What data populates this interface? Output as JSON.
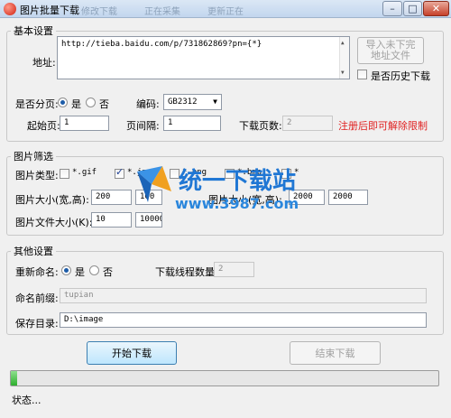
{
  "window": {
    "title": "图片批量下载",
    "ghost_items": [
      "修改下载",
      "正在采集",
      "更新正在"
    ],
    "controls": [
      "–",
      "□",
      "✕"
    ]
  },
  "basic": {
    "legend": "基本设置",
    "address_label": "地址:",
    "address_value": "http://tieba.baidu.com/p/731862869?pn={*}",
    "import_button": "导入未下完地址文件",
    "history_label": "是否历史下载",
    "paging_label": "是否分页:",
    "yes": "是",
    "no": "否",
    "encoding_label": "编码:",
    "encoding_value": "GB2312",
    "start_page_label": "起始页:",
    "start_page_value": "1",
    "interval_label": "页间隔:",
    "interval_value": "1",
    "page_count_label": "下载页数:",
    "page_count_value": "2",
    "register_note": "注册后即可解除限制"
  },
  "filter": {
    "legend": "图片筛选",
    "type_label": "图片类型:",
    "types": [
      {
        "label": "*.gif",
        "checked": false
      },
      {
        "label": "*.jpg",
        "checked": true
      },
      {
        "label": "*.png",
        "checked": false
      },
      {
        "label": "*.bmp",
        "checked": false
      },
      {
        "label": "*",
        "checked": false
      }
    ],
    "min_size_label": "图片大小(宽,高):",
    "min_w": "200",
    "min_h": "100",
    "max_size_label": "图片大小(宽,高):",
    "max_w": "2000",
    "max_h": "2000",
    "file_size_label": "图片文件大小(K):",
    "file_min": "10",
    "file_max": "10000"
  },
  "other": {
    "legend": "其他设置",
    "rename_label": "重新命名:",
    "yes": "是",
    "no": "否",
    "threads_label": "下载线程数量:",
    "threads_value": "2",
    "prefix_label": "命名前缀:",
    "prefix_value": "tupian",
    "dir_label": "保存目录:",
    "dir_value": "D:\\image"
  },
  "actions": {
    "start": "开始下载",
    "stop": "结束下载"
  },
  "progress": 0.015,
  "status": "状态...",
  "watermark": {
    "text": "统一下载站",
    "url": "www.3987.com"
  },
  "colors": {
    "accent": "#1d5ca8",
    "note": "#e02020",
    "progress": "#2eaf2e"
  }
}
